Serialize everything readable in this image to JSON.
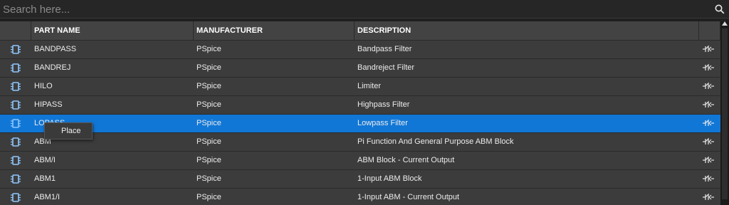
{
  "search": {
    "placeholder": "Search here..."
  },
  "columns": {
    "part_name": "PART NAME",
    "manufacturer": "MANUFACTURER",
    "description": "DESCRIPTION"
  },
  "rows": [
    {
      "part_name": "BANDPASS",
      "manufacturer": "PSpice",
      "description": "Bandpass Filter"
    },
    {
      "part_name": "BANDREJ",
      "manufacturer": "PSpice",
      "description": "Bandreject Filter"
    },
    {
      "part_name": "HILO",
      "manufacturer": "PSpice",
      "description": "Limiter"
    },
    {
      "part_name": "HIPASS",
      "manufacturer": "PSpice",
      "description": "Highpass Filter"
    },
    {
      "part_name": "LOPASS",
      "manufacturer": "PSpice",
      "description": "Lowpass Filter"
    },
    {
      "part_name": "ABM",
      "manufacturer": "PSpice",
      "description": "Pi Function And General Purpose ABM Block"
    },
    {
      "part_name": "ABM/I",
      "manufacturer": "PSpice",
      "description": "ABM Block - Current Output"
    },
    {
      "part_name": "ABM1",
      "manufacturer": "PSpice",
      "description": "1-Input ABM Block"
    },
    {
      "part_name": "ABM1/I",
      "manufacturer": "PSpice",
      "description": "1-Input ABM - Current Output"
    }
  ],
  "selected_row": 4,
  "tooltip": {
    "label": "Place"
  },
  "icons": {
    "row_icon": "chip-icon",
    "row_action": "place-part-icon",
    "search": "search-icon"
  },
  "colors": {
    "selection": "#1177d6",
    "row": "#3c3c3c",
    "header": "#434343"
  }
}
